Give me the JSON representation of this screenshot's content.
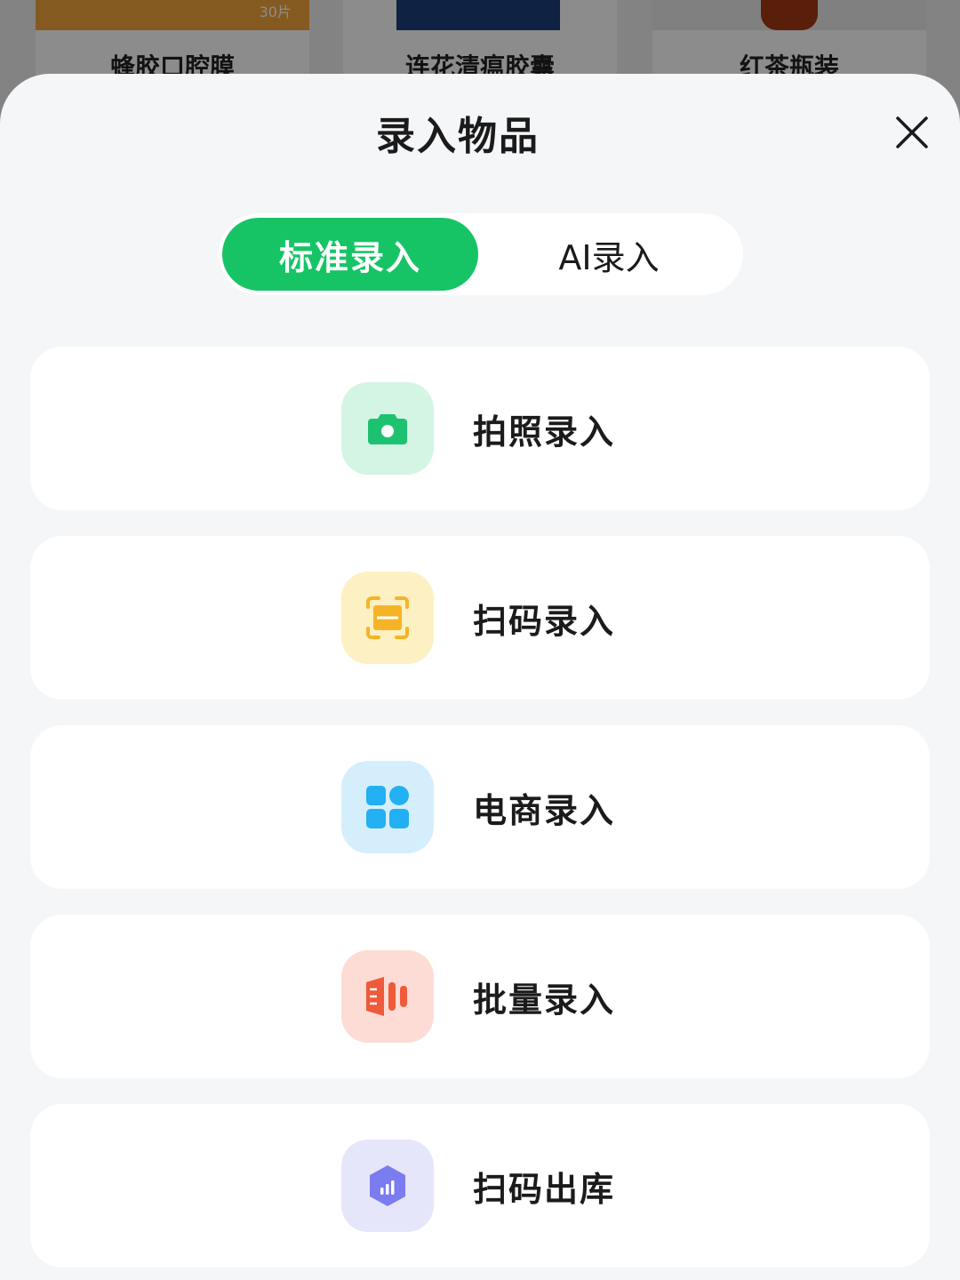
{
  "background": {
    "products": [
      {
        "name": "蜂胶口腔膜",
        "badge": "30片"
      },
      {
        "name": "连花清瘟胶囊"
      },
      {
        "name": "红茶瓶装"
      }
    ]
  },
  "sheet": {
    "title": "录入物品",
    "close_icon": "close-icon"
  },
  "mode_tabs": [
    {
      "label": "标准录入",
      "active": true
    },
    {
      "label": "AI录入",
      "active": false
    }
  ],
  "options": [
    {
      "label": "拍照录入",
      "icon": "camera-icon",
      "icon_bg": "#d4f5e4",
      "icon_color": "#1dc271"
    },
    {
      "label": "扫码录入",
      "icon": "scan-icon",
      "icon_bg": "#fdf0c2",
      "icon_color": "#f5b428"
    },
    {
      "label": "电商录入",
      "icon": "grid-icon",
      "icon_bg": "#d4eefc",
      "icon_color": "#22b0f2"
    },
    {
      "label": "批量录入",
      "icon": "batch-icon",
      "icon_bg": "#fcdcd4",
      "icon_color": "#ef5a3a"
    },
    {
      "label": "扫码出库",
      "icon": "hexagon-chart-icon",
      "icon_bg": "#e6e6fb",
      "icon_color": "#7b7cf0"
    }
  ],
  "colors": {
    "accent": "#16c466",
    "sheet_bg": "#f5f6f8",
    "text": "#1b1b1b"
  }
}
